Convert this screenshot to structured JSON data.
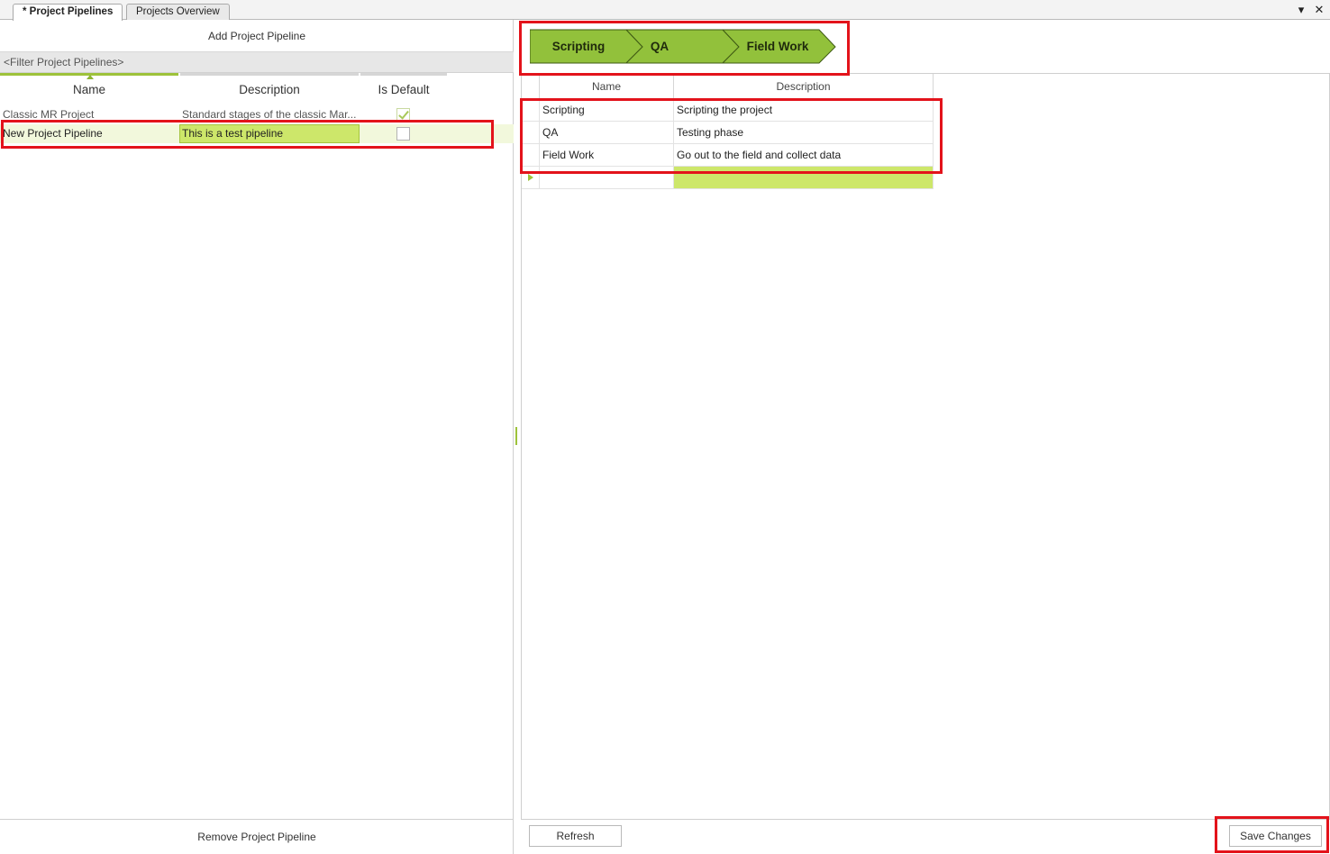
{
  "tabs": [
    {
      "label": "* Project Pipelines",
      "active": true
    },
    {
      "label": "Projects Overview",
      "active": false
    }
  ],
  "window_controls": {
    "menu": "▾",
    "close": "✕"
  },
  "left": {
    "add_button": "Add Project Pipeline",
    "filter_placeholder": "<Filter Project Pipelines>",
    "columns": {
      "name": "Name",
      "description": "Description",
      "is_default": "Is Default"
    },
    "rows": [
      {
        "name": "Classic MR Project",
        "description": "Standard stages of the classic Mar...",
        "is_default": true
      },
      {
        "name": "New Project Pipeline",
        "description": "This is a test pipeline",
        "is_default": false
      }
    ],
    "remove_button": "Remove Project Pipeline"
  },
  "right": {
    "stages": [
      "Scripting",
      "QA",
      "Field Work"
    ],
    "stage_color": "#92c13b",
    "columns": {
      "name": "Name",
      "description": "Description"
    },
    "rows": [
      {
        "name": "Scripting",
        "description": "Scripting the project"
      },
      {
        "name": "QA",
        "description": "Testing phase"
      },
      {
        "name": "Field Work",
        "description": "Go out to the field and collect data"
      }
    ],
    "refresh_button": "Refresh",
    "save_button": "Save Changes"
  },
  "colors": {
    "accent": "#9dc23a",
    "selection": "#cde76a",
    "annotation": "#e3131b"
  }
}
